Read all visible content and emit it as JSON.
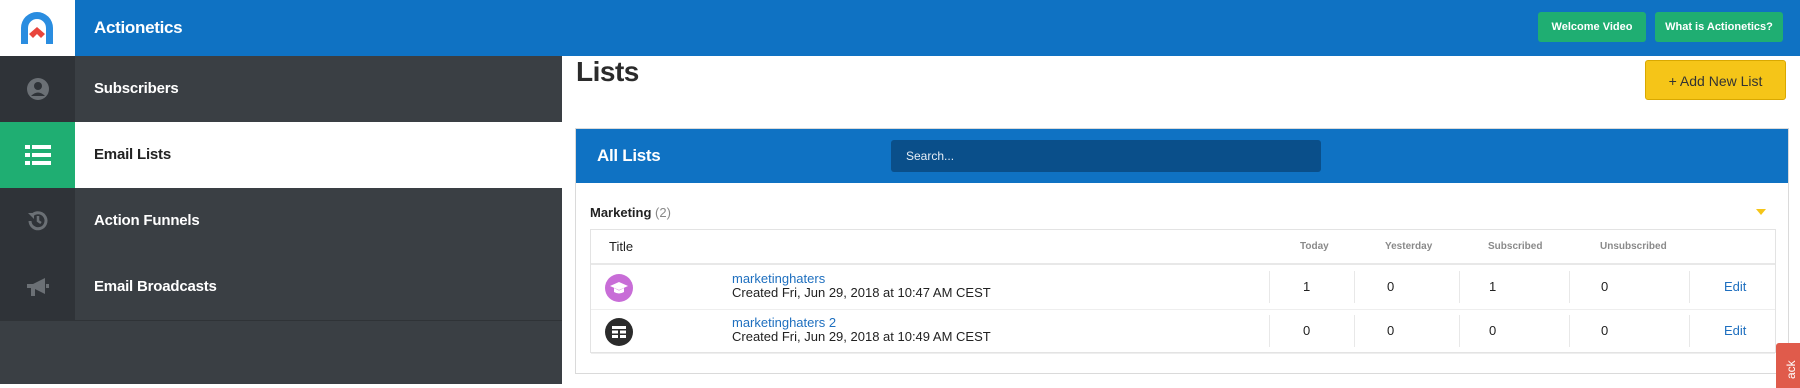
{
  "app": {
    "brand": "Actionetics"
  },
  "header": {
    "welcome_video": "Welcome Video",
    "what_is": "What is Actionetics?"
  },
  "sidebar": {
    "items": [
      {
        "label": "Subscribers",
        "icon": "user-icon"
      },
      {
        "label": "Email Lists",
        "icon": "list-icon",
        "active": true
      },
      {
        "label": "Action Funnels",
        "icon": "history-icon"
      },
      {
        "label": "Email Broadcasts",
        "icon": "megaphone-icon"
      }
    ]
  },
  "main": {
    "title": "Lists",
    "add_button": "+ Add New List",
    "panel": {
      "title": "All Lists",
      "search_placeholder": "Search...",
      "group": {
        "name": "Marketing",
        "count": "(2)"
      },
      "columns": [
        "Title",
        "Today",
        "Yesterday",
        "Subscribed",
        "Unsubscribed"
      ],
      "rows": [
        {
          "name": "marketinghaters",
          "created": "Created Fri, Jun 29, 2018 at 10:47 AM CEST",
          "today": "1",
          "yesterday": "0",
          "subscribed": "1",
          "unsubscribed": "0",
          "action": "Edit",
          "icon": "graduation-cap-icon",
          "icon_color": "#c86dd7"
        },
        {
          "name": "marketinghaters 2",
          "created": "Created Fri, Jun 29, 2018 at 10:49 AM CEST",
          "today": "0",
          "yesterday": "0",
          "subscribed": "0",
          "unsubscribed": "0",
          "action": "Edit",
          "icon": "table-icon",
          "icon_color": "#2b2b2b"
        }
      ]
    }
  },
  "feedback": {
    "label": "ack"
  },
  "colors": {
    "primary": "#0f72c3",
    "green": "#1fae72",
    "yellow": "#f5c518",
    "sidebar": "#3a3f44"
  }
}
